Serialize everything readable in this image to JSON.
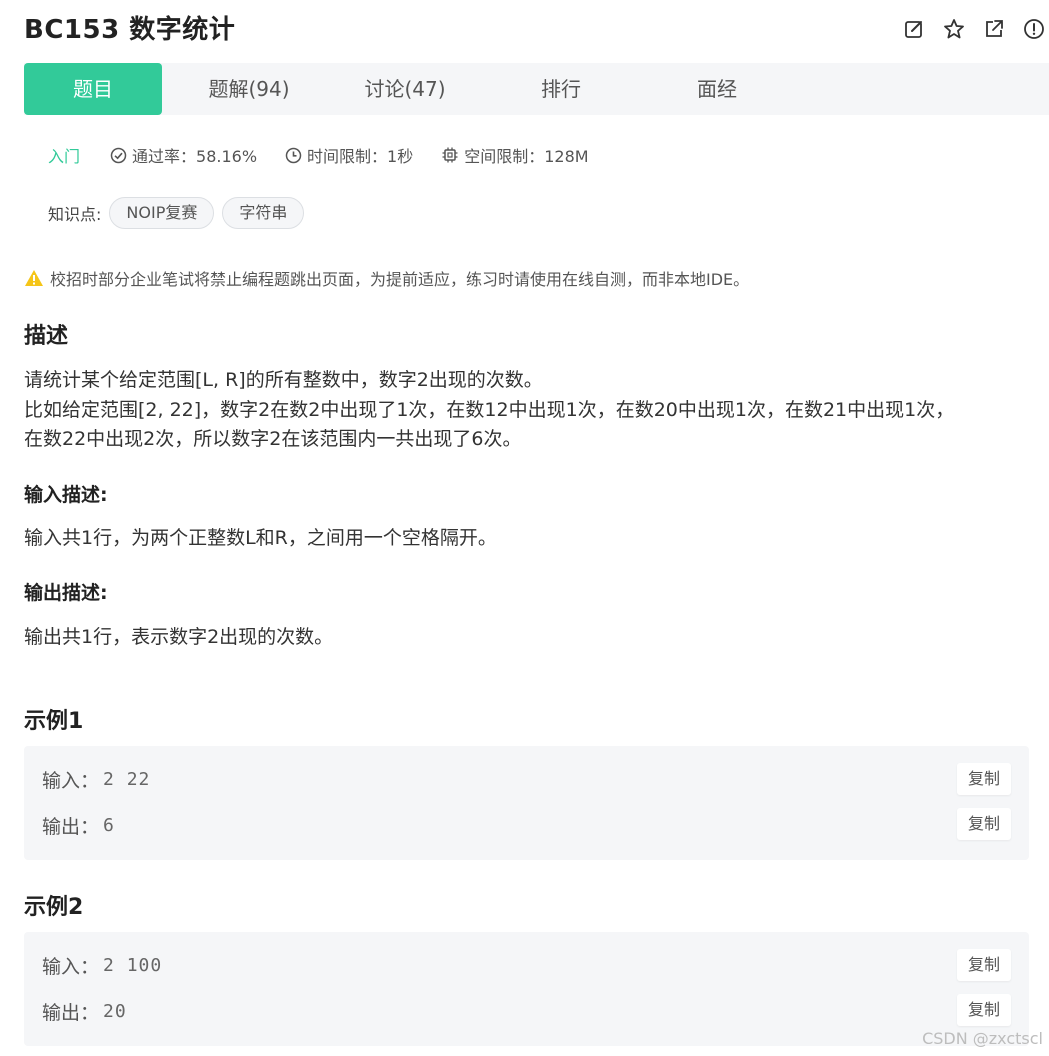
{
  "header": {
    "title": "BC153  数字统计",
    "actions": [
      "edit-icon",
      "star-icon",
      "share-icon",
      "report-icon"
    ]
  },
  "tabs": [
    {
      "label": "题目",
      "active": true
    },
    {
      "label": "题解(94)",
      "active": false
    },
    {
      "label": "讨论(47)",
      "active": false
    },
    {
      "label": "排行",
      "active": false
    },
    {
      "label": "面经",
      "active": false
    }
  ],
  "meta": {
    "level": "入门",
    "pass_rate": "通过率：58.16%",
    "time_limit": "时间限制：1秒",
    "space_limit": "空间限制：128M"
  },
  "knowledge": {
    "label": "知识点:",
    "tags": [
      "NOIP复赛",
      "字符串"
    ]
  },
  "warning": "校招时部分企业笔试将禁止编程题跳出页面，为提前适应，练习时请使用在线自测，而非本地IDE。",
  "description": {
    "heading": "描述",
    "lines": [
      "请统计某个给定范围[L, R]的所有整数中，数字2出现的次数。",
      "比如给定范围[2, 22]，数字2在数2中出现了1次，在数12中出现1次，在数20中出现1次，在数21中出现1次，",
      "在数22中出现2次，所以数字2在该范围内一共出现了6次。"
    ]
  },
  "input_desc": {
    "heading": "输入描述:",
    "text": "输入共1行，为两个正整数L和R，之间用一个空格隔开。"
  },
  "output_desc": {
    "heading": "输出描述:",
    "text": "输出共1行，表示数字2出现的次数。"
  },
  "examples": [
    {
      "heading": "示例1",
      "input_label": "输入：",
      "input": "2 22",
      "output_label": "输出：",
      "output": "6",
      "copy_label": "复制"
    },
    {
      "heading": "示例2",
      "input_label": "输入：",
      "input": "2 100",
      "output_label": "输出：",
      "output": "20",
      "copy_label": "复制"
    }
  ],
  "watermark": "CSDN @zxctscl",
  "colors": {
    "accent": "#32ca99",
    "warning": "#f5c518"
  }
}
